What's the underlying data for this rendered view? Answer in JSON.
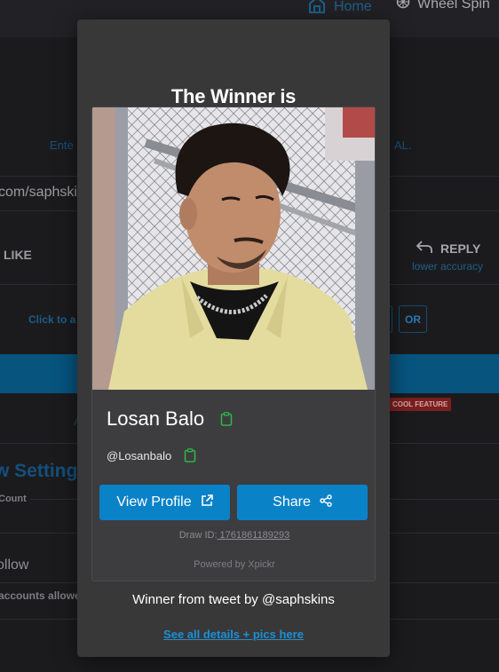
{
  "background": {
    "nav": {
      "home_label": "Home",
      "wheel_label": "Wheel Spin"
    },
    "hint_left": "Ente",
    "hint_right": "AL.",
    "url_fragment": "com/saphski",
    "like_label": "LIKE",
    "reply_label": "REPLY",
    "reply_sub": "lower accuracy",
    "click_hint": "Click to a",
    "or_label": "OR",
    "a_fragment": "A",
    "cool_feature_badge": "COOL FEATURE",
    "settings_heading": "w Setting",
    "count_label": "Count",
    "follow_label": "ollow",
    "accounts_label": "accounts allowe"
  },
  "modal": {
    "title": "The Winner is",
    "winner": {
      "name": "Losan Balo",
      "handle": "@Losanbalo"
    },
    "buttons": {
      "view_profile": "View Profile",
      "share": "Share"
    },
    "draw_id_label": "Draw ID:",
    "draw_id_value": " 1761861189293",
    "powered_by": "Powered by Xpickr",
    "from_tweet": "Winner from tweet by @saphskins",
    "details_link": "See all details + pics here"
  },
  "colors": {
    "accent": "#0a82c8",
    "link": "#1d8fd6",
    "copy_icon": "#2fb34a",
    "modal_bg": "#383838"
  },
  "icons": {
    "home": "home-icon",
    "wheel": "wheel-icon",
    "reply": "reply-arrow-icon",
    "copy": "clipboard-icon",
    "external": "external-link-icon",
    "share": "share-icon"
  }
}
